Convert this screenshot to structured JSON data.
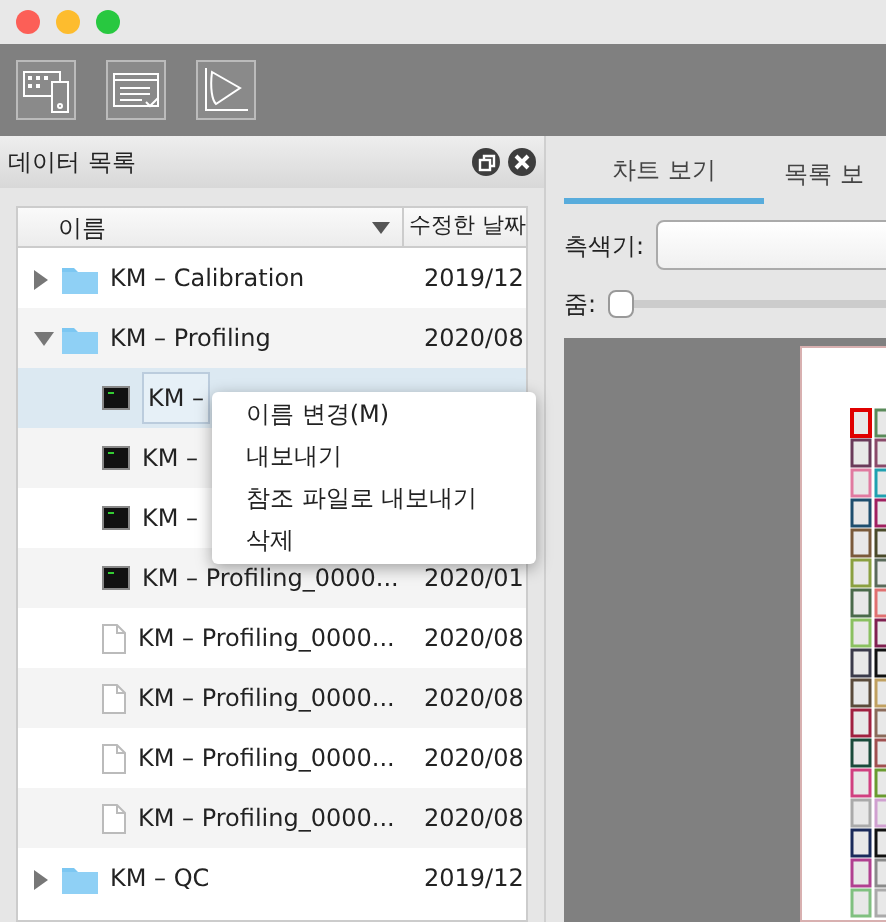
{
  "data_panel": {
    "title": "데이터 목록",
    "columns": [
      "이름",
      "수정한 날짜"
    ],
    "tree": [
      {
        "kind": "folder",
        "name": "KM – Calibration",
        "date": "2019/12",
        "expanded": false,
        "selected": false
      },
      {
        "kind": "folder",
        "name": "KM – Profiling",
        "date": "2020/08",
        "expanded": true,
        "selected": false,
        "children": [
          {
            "kind": "measurement",
            "name": "KM –",
            "selected": true
          },
          {
            "kind": "measurement",
            "name": "KM –",
            "selected": false
          },
          {
            "kind": "measurement",
            "name": "KM –",
            "selected": false
          },
          {
            "kind": "measurement",
            "name": "KM – Profiling_0000...",
            "date": "2020/01",
            "selected": false
          },
          {
            "kind": "document",
            "name": "KM – Profiling_0000...",
            "date": "2020/08",
            "selected": false
          },
          {
            "kind": "document",
            "name": "KM – Profiling_0000...",
            "date": "2020/08",
            "selected": false
          },
          {
            "kind": "document",
            "name": "KM – Profiling_0000...",
            "date": "2020/08",
            "selected": false
          },
          {
            "kind": "document",
            "name": "KM – Profiling_0000...",
            "date": "2020/08",
            "selected": false
          }
        ]
      },
      {
        "kind": "folder",
        "name": "KM – QC",
        "date": "2019/12",
        "expanded": false,
        "selected": false
      }
    ]
  },
  "context_menu": [
    "이름 변경(M)",
    "내보내기",
    "참조 파일로 내보내기",
    "삭제"
  ],
  "view_panel": {
    "tabs": [
      {
        "label": "차트 보기",
        "selected": true
      },
      {
        "label": "목록 보",
        "selected": false
      }
    ],
    "instrument": {
      "label": "측색기:"
    },
    "zoom": {
      "label": "줌:",
      "level": 0
    }
  }
}
